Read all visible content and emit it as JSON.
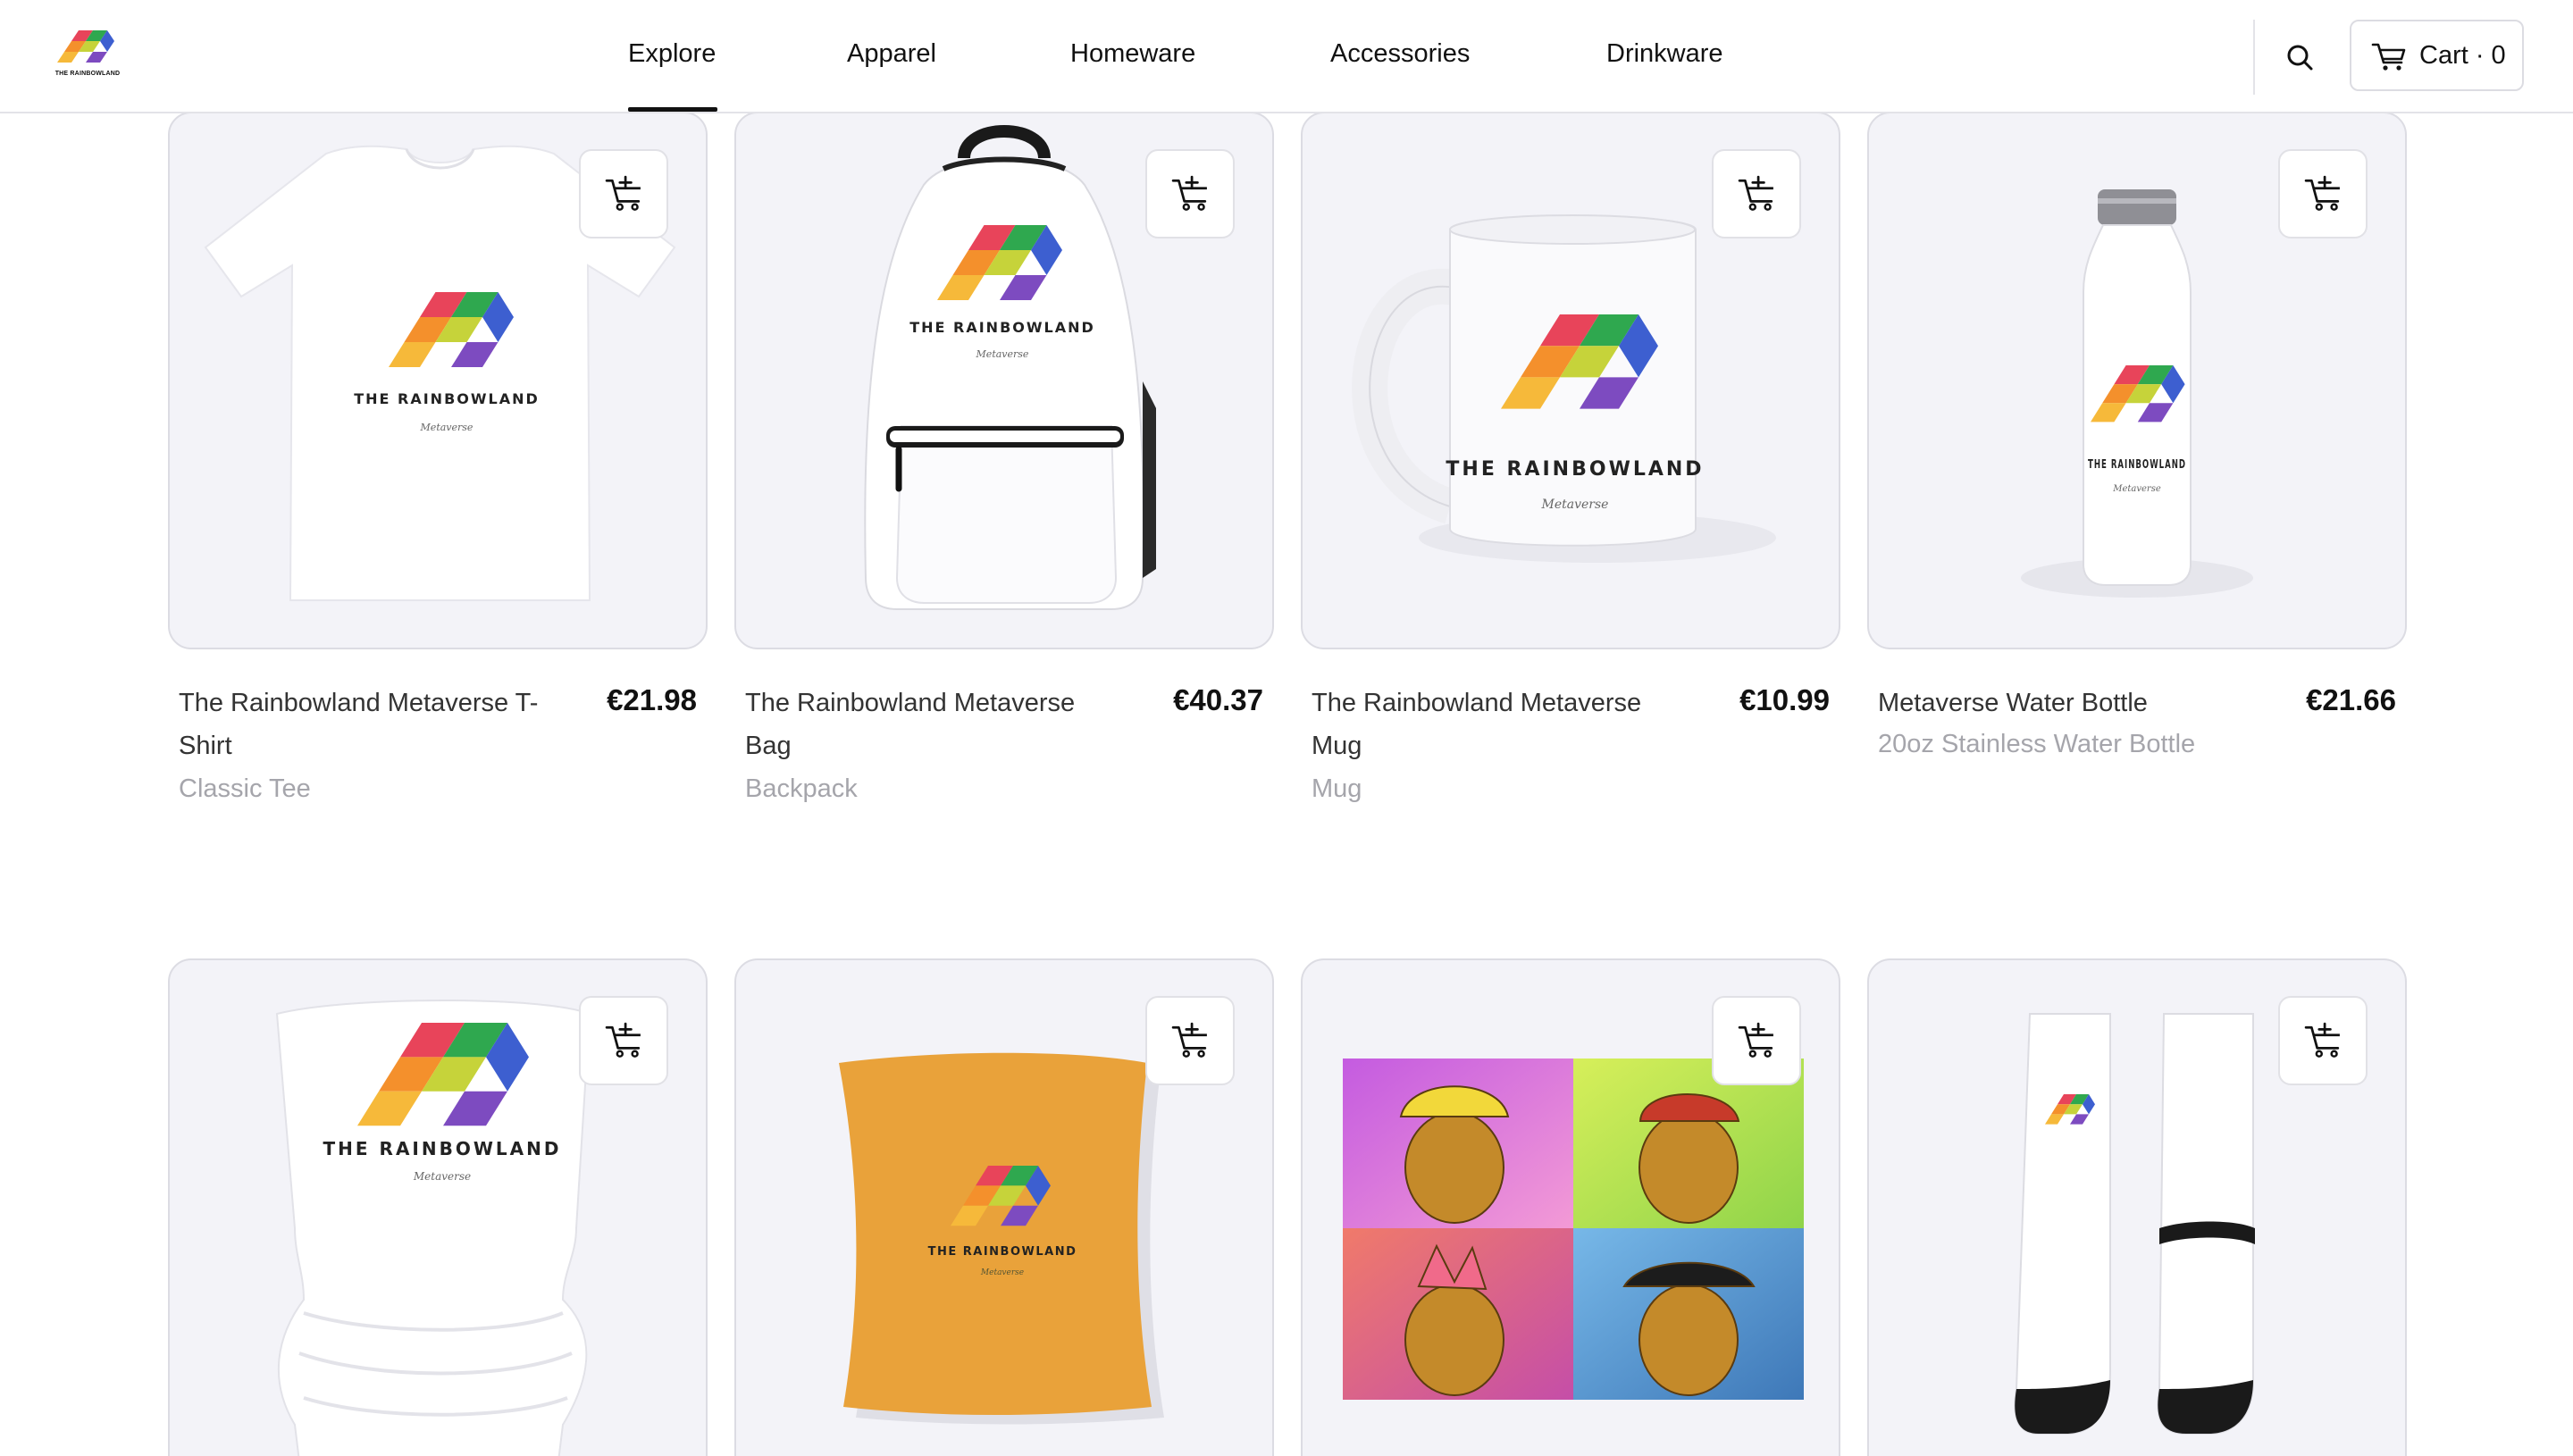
{
  "brand": {
    "logo_text": "THE RAINBOWLAND",
    "logo_colors": [
      "#f4902c",
      "#e8445a",
      "#7d4bc0",
      "#3d5fd0",
      "#2fa84f",
      "#c6d33a"
    ]
  },
  "nav": {
    "items": [
      {
        "label": "Explore",
        "active": true
      },
      {
        "label": "Apparel"
      },
      {
        "label": "Homeware"
      },
      {
        "label": "Accessories"
      },
      {
        "label": "Drinkware"
      }
    ]
  },
  "header": {
    "search_icon": "search-icon",
    "cart_icon": "cart-icon",
    "cart_label": "Cart · 0"
  },
  "products": [
    {
      "title": "The Rainbowland Metaverse T-Shirt",
      "price": "€21.98",
      "subtitle": "Classic Tee",
      "image": "t-shirt"
    },
    {
      "title": "The Rainbowland Metaverse Bag",
      "price": "€40.37",
      "subtitle": "Backpack",
      "image": "backpack"
    },
    {
      "title": "The Rainbowland Metaverse Mug",
      "price": "€10.99",
      "subtitle": "Mug",
      "image": "mug"
    },
    {
      "title": "Metaverse Water Bottle",
      "price": "€21.66",
      "subtitle": "20oz Stainless Water Bottle",
      "image": "water-bottle"
    },
    {
      "image": "neck-gaiter"
    },
    {
      "image": "pillow"
    },
    {
      "image": "ape-art-print"
    },
    {
      "image": "socks"
    }
  ],
  "print": {
    "brand_line": "THE RAINBOWLAND",
    "tag_line": "Metaverse"
  },
  "add_to_cart_icon": "add-to-cart-icon",
  "colors": {
    "card_bg": "#f3f3f8",
    "card_border": "#dcdce3",
    "muted_text": "#a5a5ab",
    "pillow": "#e9a23a"
  }
}
